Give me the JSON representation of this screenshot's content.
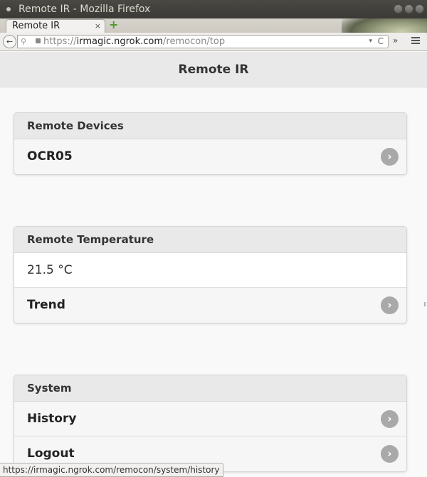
{
  "window": {
    "title": "Remote IR - Mozilla Firefox"
  },
  "tab": {
    "label": "Remote IR",
    "close": "×",
    "new_tab": "+"
  },
  "nav": {
    "back": "←",
    "url_scheme": "https://",
    "url_host": "irmagic.ngrok.com",
    "url_path": "/remocon/top",
    "dropdown": "▾",
    "reload": "C",
    "overflow": "»"
  },
  "page": {
    "title": "Remote IR",
    "sections": [
      {
        "header": "Remote Devices",
        "rows": [
          {
            "label": "OCR05"
          }
        ]
      },
      {
        "header": "Remote Temperature",
        "value": "21.5 °C",
        "rows": [
          {
            "label": "Trend"
          }
        ]
      },
      {
        "header": "System",
        "rows": [
          {
            "label": "History"
          },
          {
            "label": "Logout"
          }
        ]
      }
    ]
  },
  "status": {
    "url": "https://irmagic.ngrok.com/remocon/system/history"
  },
  "icons": {
    "chevron": "chevron-right-icon"
  },
  "colors": {
    "header_bg": "#e9e9e9",
    "chevron_bg": "#a9a9a9",
    "page_bg": "#f9f9f9"
  }
}
